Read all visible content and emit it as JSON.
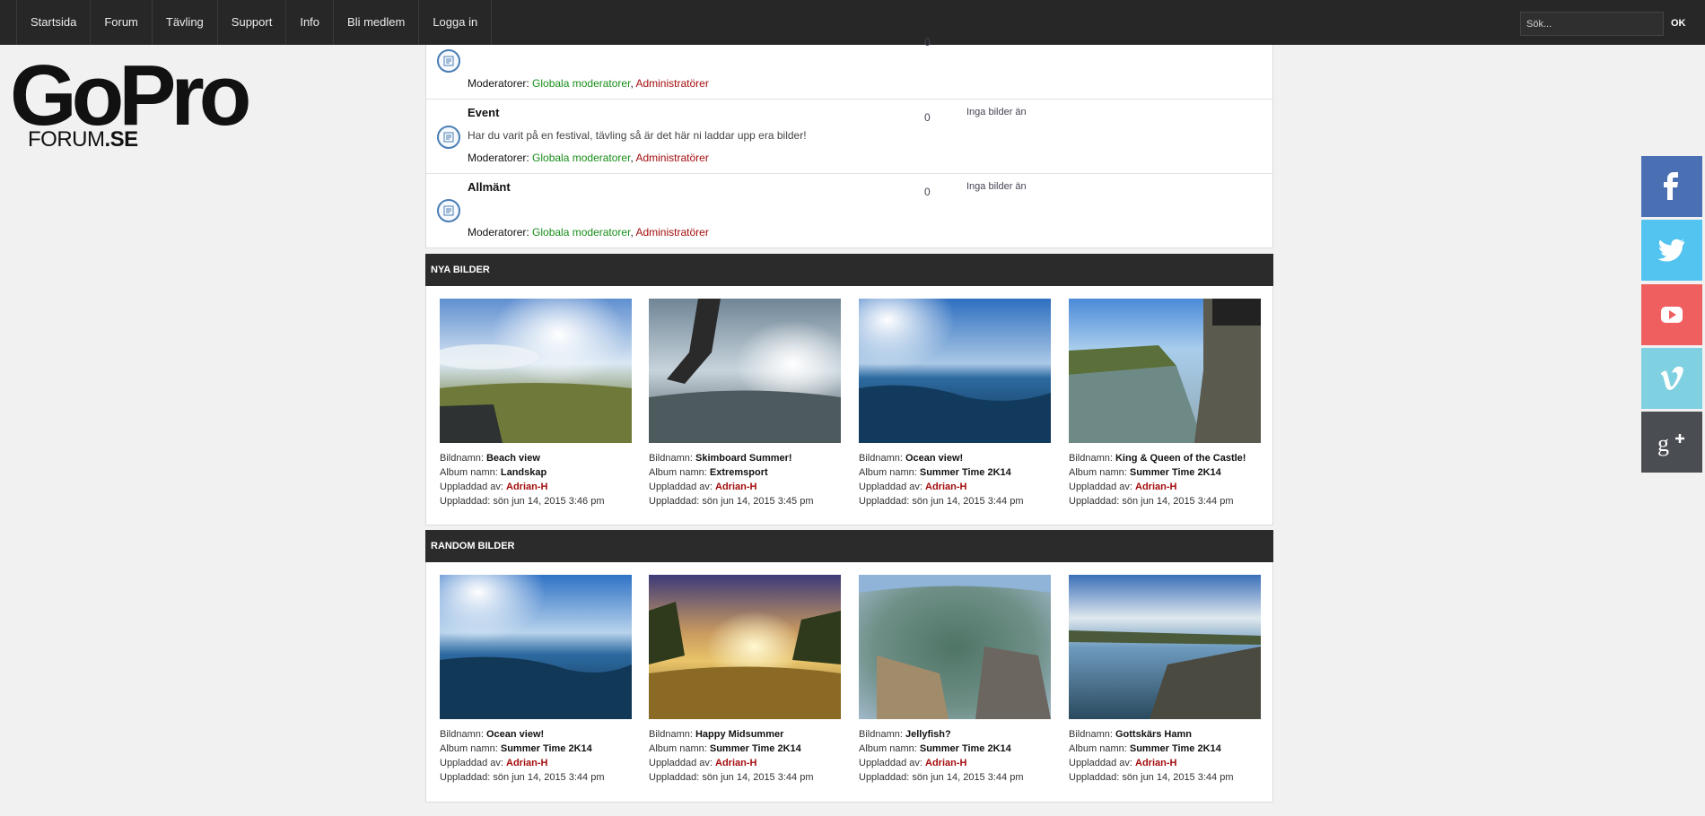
{
  "nav": {
    "items": [
      "Startsida",
      "Forum",
      "Tävling",
      "Support",
      "Info",
      "Bli medlem",
      "Logga in"
    ],
    "search_placeholder": "Sök...",
    "search_button": "OK"
  },
  "logo": {
    "main": "GoPro",
    "sub_prefix": "FORUM",
    "sub_suffix": ".SE"
  },
  "forums": [
    {
      "title": "",
      "description": "",
      "count": "0",
      "latest": "",
      "moderators_label": "Moderatorer: ",
      "moderators": [
        "Globala moderatorer",
        "Administratörer"
      ]
    },
    {
      "title": "Event",
      "description": "Har du varit på en festival, tävling så är det här ni laddar upp era bilder!",
      "count": "0",
      "latest": "Inga bilder än",
      "moderators_label": "Moderatorer: ",
      "moderators": [
        "Globala moderatorer",
        "Administratörer"
      ]
    },
    {
      "title": "Allmänt",
      "description": "",
      "count": "0",
      "latest": "Inga bilder än",
      "moderators_label": "Moderatorer: ",
      "moderators": [
        "Globala moderatorer",
        "Administratörer"
      ]
    }
  ],
  "labels": {
    "name": "Bildnamn: ",
    "album": "Album namn: ",
    "by": "Uppladdad av: ",
    "date": "Uppladdad: "
  },
  "new_images": {
    "title": "NYA BILDER",
    "items": [
      {
        "name": "Beach view",
        "album": "Landskap",
        "user": "Adrian-H",
        "date": "sön jun 14, 2015 3:46 pm"
      },
      {
        "name": "Skimboard Summer!",
        "album": "Extremsport",
        "user": "Adrian-H",
        "date": "sön jun 14, 2015 3:45 pm"
      },
      {
        "name": "Ocean view!",
        "album": "Summer Time 2K14",
        "user": "Adrian-H",
        "date": "sön jun 14, 2015 3:44 pm"
      },
      {
        "name": "King & Queen of the Castle!",
        "album": "Summer Time 2K14",
        "user": "Adrian-H",
        "date": "sön jun 14, 2015 3:44 pm"
      }
    ]
  },
  "random_images": {
    "title": "RANDOM BILDER",
    "items": [
      {
        "name": "Ocean view!",
        "album": "Summer Time 2K14",
        "user": "Adrian-H",
        "date": "sön jun 14, 2015 3:44 pm"
      },
      {
        "name": "Happy Midsummer",
        "album": "Summer Time 2K14",
        "user": "Adrian-H",
        "date": "sön jun 14, 2015 3:44 pm"
      },
      {
        "name": "Jellyfish?",
        "album": "Summer Time 2K14",
        "user": "Adrian-H",
        "date": "sön jun 14, 2015 3:44 pm"
      },
      {
        "name": "Gottskärs Hamn",
        "album": "Summer Time 2K14",
        "user": "Adrian-H",
        "date": "sön jun 14, 2015 3:44 pm"
      }
    ]
  },
  "social": [
    {
      "icon": "facebook-icon",
      "color": "#4a6fb3"
    },
    {
      "icon": "twitter-icon",
      "color": "#52c4ef"
    },
    {
      "icon": "youtube-icon",
      "color": "#ef5f5f"
    },
    {
      "icon": "vimeo-icon",
      "color": "#7fd0e0"
    },
    {
      "icon": "google-plus-icon",
      "color": "#4a4d52"
    }
  ],
  "colors": {
    "topbar": "#272727",
    "moderator_global": "#198d19",
    "moderator_admin": "#a40d0d",
    "username": "#a40d0d"
  }
}
